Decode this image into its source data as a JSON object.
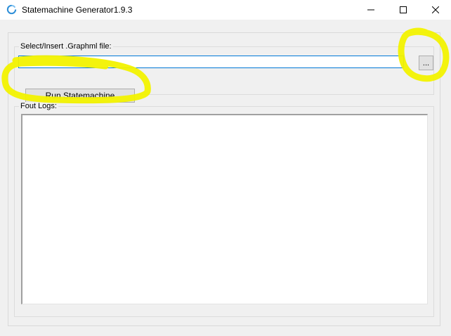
{
  "window": {
    "title": "Statemachine Generator1.9.3",
    "icon": "refresh-arrows-icon"
  },
  "titlebar_buttons": {
    "minimize_icon": "minimize-icon",
    "maximize_icon": "maximize-icon",
    "close_icon": "close-icon"
  },
  "file_group": {
    "label": "Select/Insert .Graphml file:",
    "input_value": "",
    "browse_label": "..."
  },
  "run_button": {
    "label": "Run Statemachine"
  },
  "logs_group": {
    "label": "Fout Logs:",
    "content": ""
  },
  "colors": {
    "highlight": "#f2f200",
    "focus_border": "#0078d7",
    "client_bg": "#f0f0f0"
  }
}
